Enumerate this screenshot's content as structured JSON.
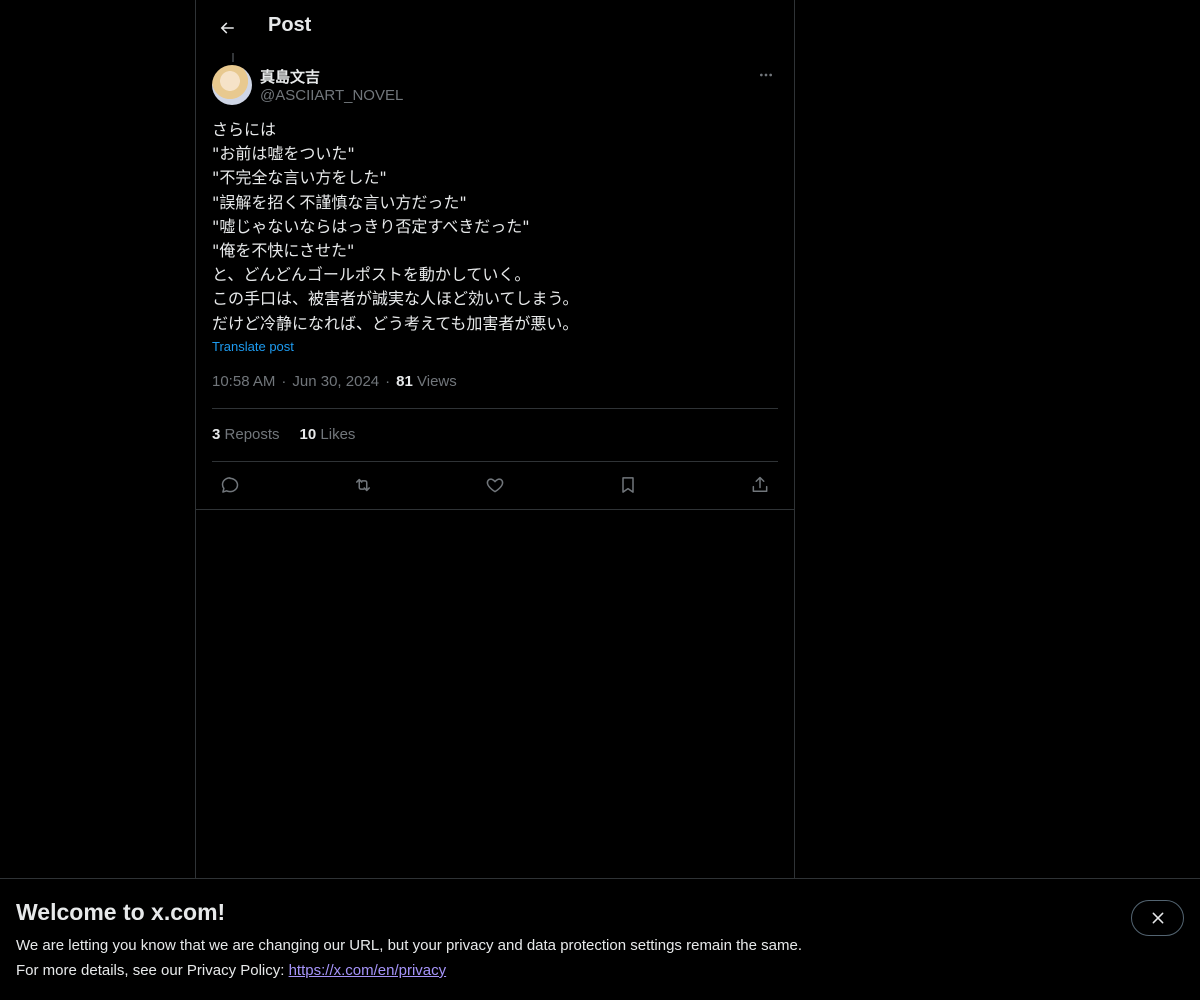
{
  "header": {
    "title": "Post"
  },
  "author": {
    "name": "真島文吉",
    "handle": "@ASCIIART_NOVEL"
  },
  "post": {
    "text": "さらには\n\"お前は嘘をついた\"\n\"不完全な言い方をした\"\n\"誤解を招く不謹慎な言い方だった\"\n\"嘘じゃないならはっきり否定すべきだった\"\n\"俺を不快にさせた\"\nと、どんどんゴールポストを動かしていく。\nこの手口は、被害者が誠実な人ほど効いてしまう。\nだけど冷静になれば、どう考えても加害者が悪い。",
    "translate_label": "Translate post",
    "time": "10:58 AM",
    "date": "Jun 30, 2024",
    "views_count": "81",
    "views_label": "Views"
  },
  "stats": {
    "reposts_count": "3",
    "reposts_label": "Reposts",
    "likes_count": "10",
    "likes_label": "Likes"
  },
  "actions": {
    "icons": [
      "reply-icon",
      "repost-icon",
      "like-icon",
      "bookmark-icon",
      "share-icon"
    ]
  },
  "banner": {
    "title": "Welcome to x.com!",
    "line1": "We are letting you know that we are changing our URL, but your privacy and data protection settings remain the same.",
    "line2_prefix": "For more details, see our Privacy Policy: ",
    "link": "https://x.com/en/privacy"
  },
  "colors": {
    "background": "#000000",
    "text": "#e7e9ea",
    "secondary_text": "#71767b",
    "link": "#1d9bf0",
    "border": "#2f3336"
  }
}
